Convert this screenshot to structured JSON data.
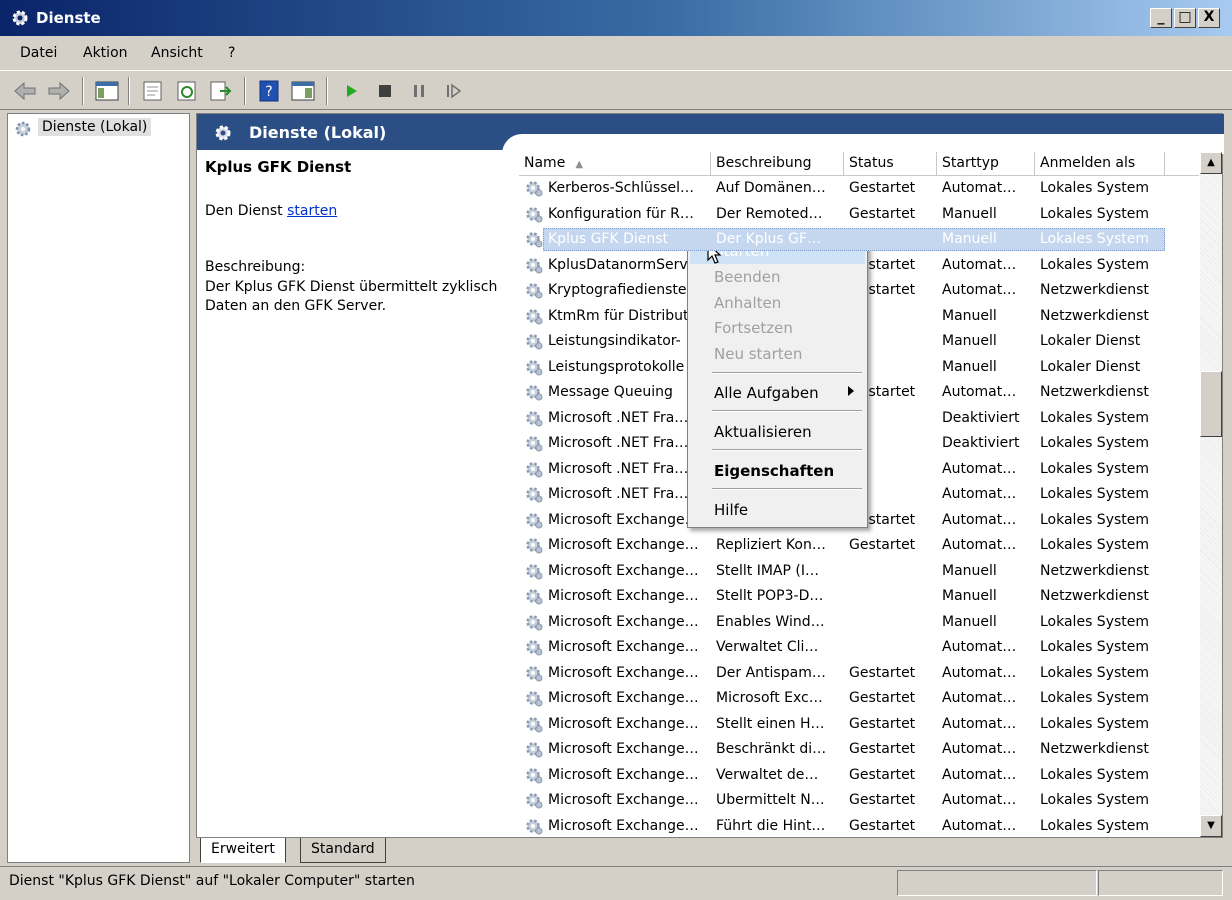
{
  "window": {
    "title": "Dienste",
    "buttons": [
      "_",
      "□",
      "X"
    ]
  },
  "menu": [
    "Datei",
    "Aktion",
    "Ansicht",
    "?"
  ],
  "tree": {
    "root": "Dienste (Lokal)"
  },
  "panel": {
    "header": "Dienste (Lokal)",
    "service_name": "Kplus GFK Dienst",
    "action_prefix": "Den Dienst ",
    "action_link": "starten",
    "desc_label": "Beschreibung:",
    "desc_text": "Der Kplus GFK Dienst übermittelt zyklisch Daten an den GFK Server."
  },
  "columns": [
    "Name",
    "Beschreibung",
    "Status",
    "Starttyp",
    "Anmelden als"
  ],
  "rows": [
    [
      "Kerberos-Schlüssel…",
      "Auf Domänen…",
      "Gestartet",
      "Automat…",
      "Lokales System"
    ],
    [
      "Konfiguration für R…",
      "Der Remoted…",
      "Gestartet",
      "Manuell",
      "Lokales System"
    ],
    [
      "Kplus GFK Dienst",
      "Der Kplus GF…",
      "",
      "Manuell",
      "Lokales System"
    ],
    [
      "KplusDatanormServ",
      "",
      "Gestartet",
      "Automat…",
      "Lokales System"
    ],
    [
      "Kryptografiedienste",
      "",
      "Gestartet",
      "Automat…",
      "Netzwerkdienst"
    ],
    [
      "KtmRm für Distribut",
      "",
      "",
      "Manuell",
      "Netzwerkdienst"
    ],
    [
      "Leistungsindikator-",
      "",
      "",
      "Manuell",
      "Lokaler Dienst"
    ],
    [
      "Leistungsprotokolle",
      "",
      "",
      "Manuell",
      "Lokaler Dienst"
    ],
    [
      "Message Queuing",
      "",
      "Gestartet",
      "Automat…",
      "Netzwerkdienst"
    ],
    [
      "Microsoft .NET Fra…",
      "",
      "",
      "Deaktiviert",
      "Lokales System"
    ],
    [
      "Microsoft .NET Fra…",
      "",
      "",
      "Deaktiviert",
      "Lokales System"
    ],
    [
      "Microsoft .NET Fra…",
      "",
      "",
      "Automat…",
      "Lokales System"
    ],
    [
      "Microsoft .NET Fra…",
      "",
      "",
      "Automat…",
      "Lokales System"
    ],
    [
      "Microsoft Exchange…",
      "",
      "Gestartet",
      "Automat…",
      "Lokales System"
    ],
    [
      "Microsoft Exchange…",
      "Repliziert Kon…",
      "Gestartet",
      "Automat…",
      "Lokales System"
    ],
    [
      "Microsoft Exchange…",
      "Stellt IMAP (I…",
      "",
      "Manuell",
      "Netzwerkdienst"
    ],
    [
      "Microsoft Exchange…",
      "Stellt POP3-D…",
      "",
      "Manuell",
      "Netzwerkdienst"
    ],
    [
      "Microsoft Exchange…",
      "Enables Wind…",
      "",
      "Manuell",
      "Lokales System"
    ],
    [
      "Microsoft Exchange…",
      "Verwaltet Cli…",
      "",
      "Automat…",
      "Lokales System"
    ],
    [
      "Microsoft Exchange…",
      "Der Antispam…",
      "Gestartet",
      "Automat…",
      "Lokales System"
    ],
    [
      "Microsoft Exchange…",
      "Microsoft Exc…",
      "Gestartet",
      "Automat…",
      "Lokales System"
    ],
    [
      "Microsoft Exchange…",
      "Stellt einen H…",
      "Gestartet",
      "Automat…",
      "Lokales System"
    ],
    [
      "Microsoft Exchange…",
      "Beschränkt di…",
      "Gestartet",
      "Automat…",
      "Netzwerkdienst"
    ],
    [
      "Microsoft Exchange…",
      "Verwaltet de…",
      "Gestartet",
      "Automat…",
      "Lokales System"
    ],
    [
      "Microsoft Exchange…",
      "Übermittelt N…",
      "Gestartet",
      "Automat…",
      "Lokales System"
    ],
    [
      "Microsoft Exchange…",
      "Führt die Hint…",
      "Gestartet",
      "Automat…",
      "Lokales System"
    ]
  ],
  "context_menu": {
    "start": "Starten",
    "stop": "Beenden",
    "pause": "Anhalten",
    "resume": "Fortsetzen",
    "restart": "Neu starten",
    "all_tasks": "Alle Aufgaben",
    "refresh": "Aktualisieren",
    "properties": "Eigenschaften",
    "help": "Hilfe"
  },
  "tabs": [
    "Erweitert",
    "Standard"
  ],
  "status": "Dienst \"Kplus GFK Dienst\" auf \"Lokaler Computer\" starten",
  "colors": {
    "title_start": "#0a246a",
    "header_bg": "#2b4f85",
    "selection": "#316ac5",
    "link": "#0033cc"
  }
}
